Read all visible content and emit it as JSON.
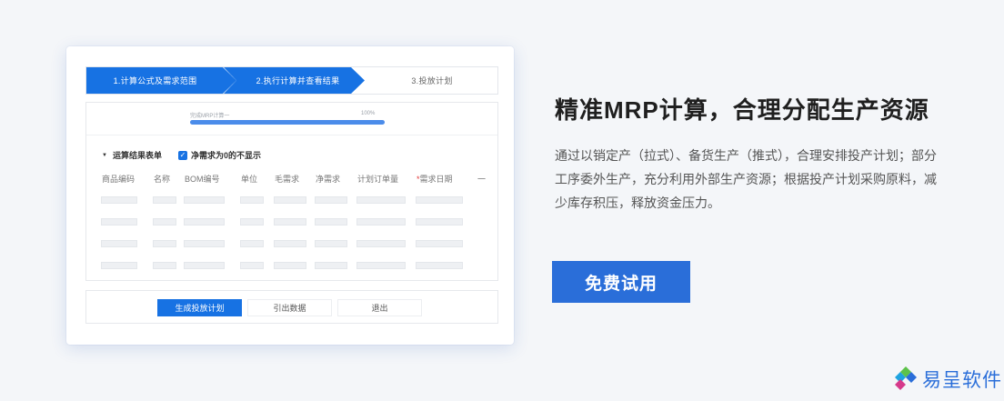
{
  "mockup": {
    "steps": [
      "1.计算公式及需求范围",
      "2.执行计算并查看结果",
      "3.投放计划"
    ],
    "progress": {
      "label": "完成MRP计算一",
      "percent_text": "100%",
      "percent": 100
    },
    "result_section": {
      "title": "运算结果表单",
      "checkbox_label": "净需求为0的不显示",
      "checkbox_checked": true
    },
    "columns": [
      "商品编码",
      "名称",
      "BOM编号",
      "单位",
      "毛需求",
      "净需求",
      "计划订单量",
      "需求日期",
      "一"
    ],
    "required_column": "需求日期",
    "placeholder_rows": 4,
    "buttons": [
      "生成投放计划",
      "引出数据",
      "退出"
    ]
  },
  "headline": "精准MRP计算，合理分配生产资源",
  "description": "通过以销定产（拉式）、备货生产（推式），合理安排投产计划；部分工序委外生产，充分利用外部生产资源；根据投产计划采购原料，减少库存积压，释放资金压力。",
  "cta_label": "免费试用",
  "logo_text": "易呈软件",
  "colors": {
    "accent": "#1772e3",
    "cta": "#2a6ed9",
    "background": "#f4f6f9"
  }
}
